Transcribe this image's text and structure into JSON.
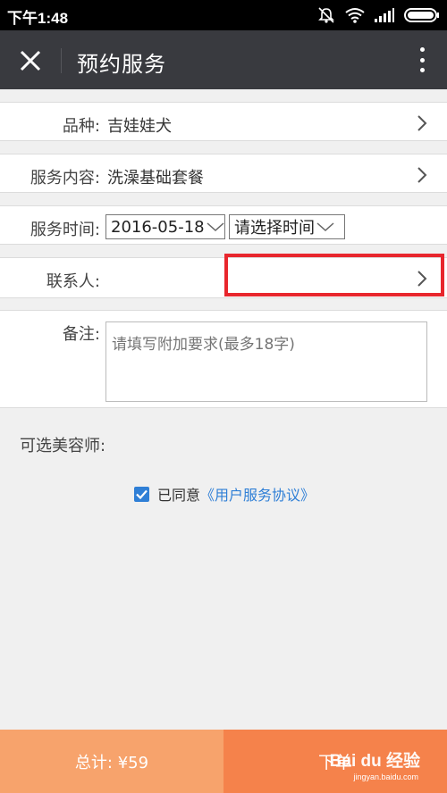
{
  "status_bar": {
    "time": "下午1:48",
    "icons": [
      "mute-icon",
      "wifi-icon",
      "signal-icon",
      "battery-icon"
    ]
  },
  "header": {
    "title": "预约服务",
    "close_icon": "close-icon",
    "more_icon": "more-vertical-icon"
  },
  "form": {
    "breed": {
      "label": "品种:",
      "value": "吉娃娃犬"
    },
    "service": {
      "label": "服务内容:",
      "value": "洗澡基础套餐"
    },
    "time": {
      "label": "服务时间:",
      "date_value": "2016-05-18",
      "time_value": "请选择时间"
    },
    "contact": {
      "label": "联系人:",
      "value": ""
    },
    "note": {
      "label": "备注:",
      "placeholder": "请填写附加要求(最多18字)"
    }
  },
  "stylist": {
    "label": "可选美容师:"
  },
  "agreement": {
    "checked": true,
    "text": "已同意",
    "link": "《用户服务协议》"
  },
  "footer": {
    "total": "总计: ¥59",
    "order_button": "下单",
    "watermark": "Bai du 经验",
    "watermark_url": "jingyan.baidu.com"
  },
  "colors": {
    "title_bar": "#393a3f",
    "highlight": "#e8262d",
    "accent_blue": "#2f7fd6",
    "total_bg": "#f7a36c",
    "order_bg": "#f5824b"
  }
}
